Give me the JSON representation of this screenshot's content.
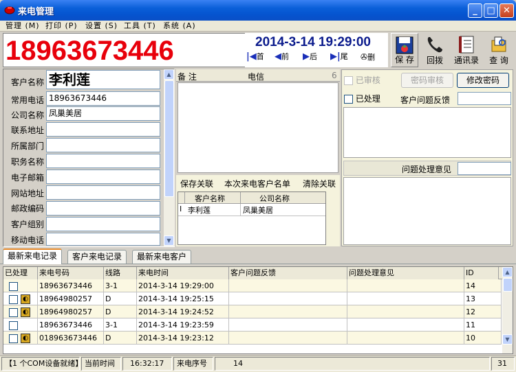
{
  "window": {
    "title": "来电管理"
  },
  "menu": [
    {
      "label": "管理 (M)"
    },
    {
      "label": "打印 (P)"
    },
    {
      "label": "设置 (S)"
    },
    {
      "label": "工具 (T)"
    },
    {
      "label": "系统 (A)"
    }
  ],
  "header": {
    "phone_number": "18963673446",
    "datetime": "2014-3-14 19:29:00",
    "nav": {
      "first": "首",
      "prev": "前",
      "next": "后",
      "last": "尾",
      "delete": "删"
    }
  },
  "toolbar": {
    "save": "保 存",
    "callback": "回拨",
    "contacts": "通讯录",
    "query": "查 询"
  },
  "customer_form": {
    "name_label": "客户名称",
    "name_value": "李利莲",
    "phone_label": "常用电话",
    "phone_value": "18963673446",
    "company_label": "公司名称",
    "company_value": "凤巢美居",
    "address_label": "联系地址",
    "dept_label": "所属部门",
    "position_label": "职务名称",
    "email_label": "电子邮箱",
    "website_label": "网站地址",
    "postcode_label": "邮政编码",
    "group_label": "客户组别",
    "mobile_label": "移动电话"
  },
  "notes": {
    "label": "备  注",
    "carrier": "电信",
    "count": "6"
  },
  "linkbar": {
    "save_link": "保存关联",
    "call_list": "本次来电客户名单",
    "clear_link": "清除关联"
  },
  "link_table": {
    "columns": [
      "客户名称",
      "公司名称"
    ],
    "rows": [
      {
        "marker": "I",
        "name": "李利莲",
        "company": "凤巢美居"
      }
    ]
  },
  "right_panel": {
    "reviewed": "已审核",
    "review_pwd": "密码审核",
    "change_pwd": "修改密码",
    "processed": "已处理",
    "feedback": "客户问题反馈",
    "handling": "问题处理意见"
  },
  "tabs": [
    "最新来电记录",
    "客户来电记录",
    "最新来电客户"
  ],
  "grid": {
    "columns": [
      "已处理",
      "来电号码",
      "线路",
      "来电时间",
      "客户问题反馈",
      "问题处理意见",
      "ID"
    ],
    "rows": [
      {
        "number": "18963673446",
        "line": "3-1",
        "time": "2014-3-14 19:29:00",
        "id": "14",
        "icon": false
      },
      {
        "number": "18964980257",
        "line": "D",
        "time": "2014-3-14 19:25:15",
        "id": "13",
        "icon": true
      },
      {
        "number": "18964980257",
        "line": "D",
        "time": "2014-3-14 19:24:52",
        "id": "12",
        "icon": true
      },
      {
        "number": "18963673446",
        "line": "3-1",
        "time": "2014-3-14 19:23:59",
        "id": "11",
        "icon": false
      },
      {
        "number": "018963673446",
        "line": "D",
        "time": "2014-3-14 19:23:12",
        "id": "10",
        "icon": true
      }
    ]
  },
  "status": {
    "device": "【1 个COM设备就绪】",
    "time_label": "当前时间",
    "time_value": "16:32:17",
    "seq_label": "来电序号",
    "seq_value": "14",
    "right_value": "31"
  },
  "colors": {
    "accent_red": "#e8000b",
    "date_blue": "#0a1a8c",
    "row_alt": "#fbf8e2",
    "title_blue": "#0a5fd8"
  }
}
